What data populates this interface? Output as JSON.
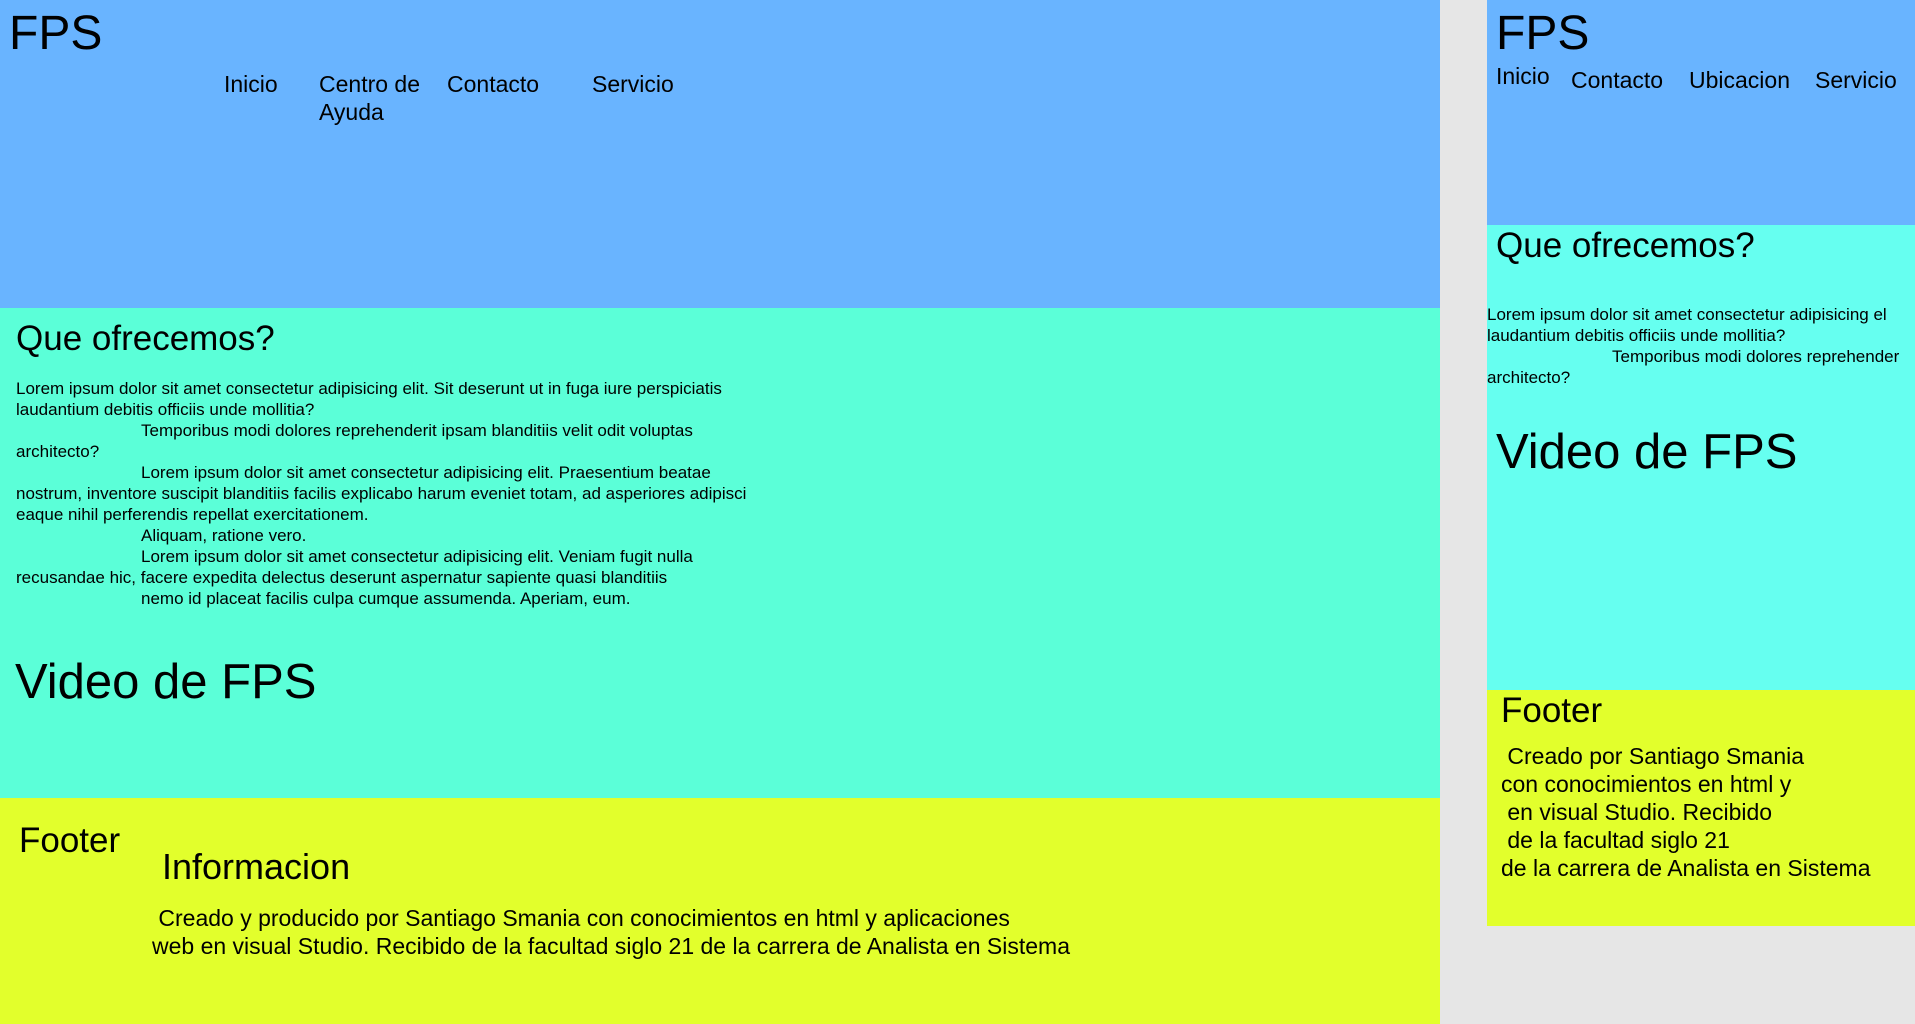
{
  "colors": {
    "header": "#69b4ff",
    "main_desktop": "#5bffd8",
    "main_mobile": "#66fff0",
    "footer": "#e2ff2c",
    "background": "#e6e6e6"
  },
  "desktop": {
    "header": {
      "logo": "FPS",
      "nav": [
        "Inicio",
        "Centro de Ayuda",
        "Contacto",
        "Servicio"
      ]
    },
    "main": {
      "heading": "Que ofrecemos?",
      "paragraph": {
        "line1": "Lorem ipsum dolor sit amet consectetur adipisicing elit. Sit deserunt ut in fuga iure perspiciatis",
        "line2": "laudantium debitis officiis unde mollitia?",
        "line3": "Temporibus modi dolores reprehenderit ipsam blanditiis velit odit voluptas",
        "line4": "architecto?",
        "line5": "Lorem ipsum dolor sit amet consectetur adipisicing elit. Praesentium beatae",
        "line6": "nostrum, inventore suscipit blanditiis facilis explicabo harum eveniet totam, ad asperiores adipisci",
        "line7": "eaque nihil perferendis repellat exercitationem.",
        "line8": "Aliquam, ratione vero.",
        "line9": "Lorem ipsum dolor sit amet consectetur adipisicing elit. Veniam fugit nulla",
        "line10": "recusandae hic, facere expedita delectus deserunt aspernatur sapiente quasi blanditiis",
        "line11": "nemo id placeat facilis culpa cumque assumenda. Aperiam, eum."
      },
      "video_title": "Video de FPS"
    },
    "footer": {
      "title": "Footer",
      "info_title": "Informacion",
      "text": " Creado y producido por Santiago Smania con conocimientos en html y aplicaciones\nweb en visual Studio. Recibido de la facultad siglo 21 de la carrera de Analista en Sistema"
    }
  },
  "mobile": {
    "header": {
      "logo": "FPS",
      "nav": [
        "Inicio",
        "Contacto",
        "Ubicacion",
        "Servicio"
      ]
    },
    "main": {
      "heading": "Que ofrecemos?",
      "paragraph": {
        "line1": "Lorem ipsum dolor sit amet consectetur adipisicing el",
        "line2": "laudantium debitis officiis unde mollitia?",
        "line3": "Temporibus modi dolores reprehender",
        "line4": "architecto?"
      },
      "video_title": "Video de FPS"
    },
    "footer": {
      "title": "Footer",
      "text": " Creado por Santiago Smania\ncon conocimientos en html y\n en visual Studio. Recibido\n de la facultad siglo 21\nde la carrera de Analista en Sistema"
    }
  }
}
